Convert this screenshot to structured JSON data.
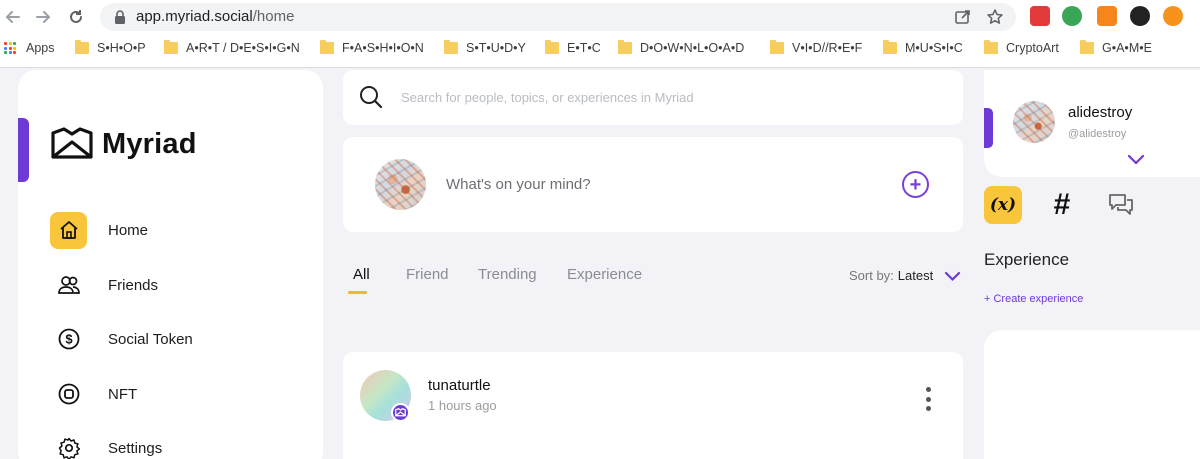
{
  "browser": {
    "url_host": "app.myriad.social",
    "url_path": "/home",
    "bookmarks": [
      {
        "label": "Apps",
        "type": "apps"
      },
      {
        "label": "S•H•O•P",
        "type": "folder"
      },
      {
        "label": "A•R•T / D•E•S•I•G•N",
        "type": "folder"
      },
      {
        "label": "F•A•S•H•I•O•N",
        "type": "folder"
      },
      {
        "label": "S•T•U•D•Y",
        "type": "folder"
      },
      {
        "label": "E•T•C",
        "type": "folder"
      },
      {
        "label": "D•O•W•N•L•O•A•D",
        "type": "folder"
      },
      {
        "label": "V•I•D//R•E•F",
        "type": "folder"
      },
      {
        "label": "M•U•S•I•C",
        "type": "folder"
      },
      {
        "label": "CryptoArt",
        "type": "folder"
      },
      {
        "label": "G•A•M•E",
        "type": "folder"
      }
    ]
  },
  "brand": {
    "name": "Myriad",
    "accent": "#6e3ad5",
    "highlight": "#f9c53a"
  },
  "sidebar": {
    "items": [
      {
        "label": "Home",
        "icon": "home-icon",
        "active": true
      },
      {
        "label": "Friends",
        "icon": "friends-icon"
      },
      {
        "label": "Social Token",
        "icon": "dollar-coin-icon"
      },
      {
        "label": "NFT",
        "icon": "nft-icon"
      },
      {
        "label": "Settings",
        "icon": "gear-icon"
      }
    ]
  },
  "search": {
    "placeholder": "Search for people, topics, or experiences in Myriad"
  },
  "composer": {
    "placeholder": "What's on your mind?"
  },
  "feed": {
    "tabs": [
      {
        "label": "All",
        "active": true
      },
      {
        "label": "Friend"
      },
      {
        "label": "Trending"
      },
      {
        "label": "Experience"
      }
    ],
    "sort_label": "Sort by:",
    "sort_value": "Latest"
  },
  "post": {
    "username": "tunaturtle",
    "time": "1 hours ago"
  },
  "profile": {
    "name": "alidestroy",
    "handle": "@alidestroy"
  },
  "right_panel": {
    "fx_label": "(x)",
    "hash_label": "#",
    "title": "Experience",
    "create_label": "+ Create experience"
  }
}
